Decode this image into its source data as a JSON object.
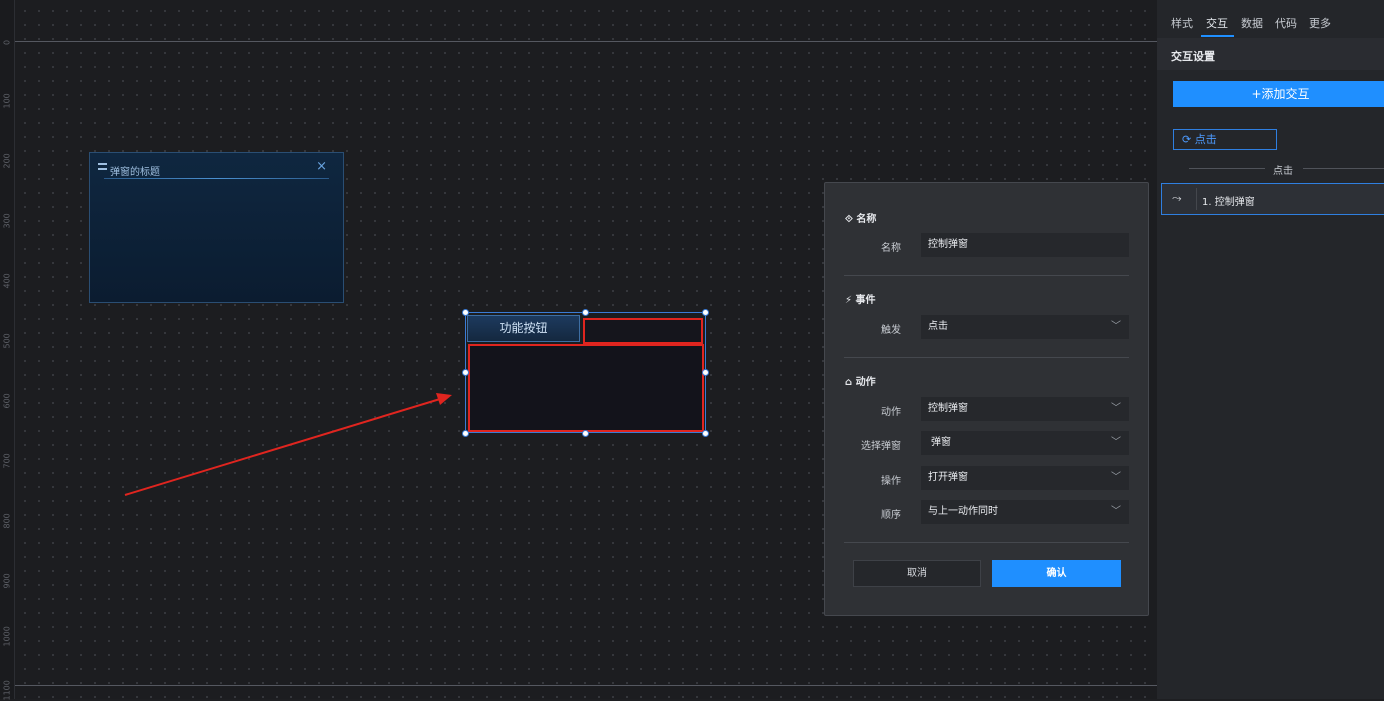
{
  "ruler": {
    "ticks": [
      "0",
      "100",
      "200",
      "300",
      "400",
      "500",
      "600",
      "700",
      "800",
      "900",
      "1000",
      "1100"
    ]
  },
  "canvas": {
    "modal_preview": {
      "title": "弹窗的标题",
      "close_glyph": "×"
    },
    "function_button": {
      "label": "功能按钮"
    }
  },
  "panel": {
    "tabs": [
      "样式",
      "交互",
      "数据",
      "代码",
      "更多"
    ],
    "active_tab": "交互",
    "section_title": "交互设置",
    "add_button": "+添加交互",
    "trigger_chip": "点击",
    "divider_label": "点击",
    "action_item": "1. 控制弹窗"
  },
  "dialog": {
    "group_name": "名称",
    "name_label": "名称",
    "name_value": "控制弹窗",
    "group_event": "事件",
    "trigger_label": "触发",
    "trigger_value": "点击",
    "group_action": "动作",
    "action_label": "动作",
    "action_value": "控制弹窗",
    "select_popup_label": "选择弹窗",
    "select_popup_value": "弹窗",
    "operation_label": "操作",
    "operation_value": "打开弹窗",
    "order_label": "顺序",
    "order_value": "与上一动作同时",
    "cancel": "取消",
    "confirm": "确认"
  },
  "colors": {
    "accent": "#1f8fff",
    "highlight_red": "#e0251f",
    "background": "#1c1d20"
  }
}
